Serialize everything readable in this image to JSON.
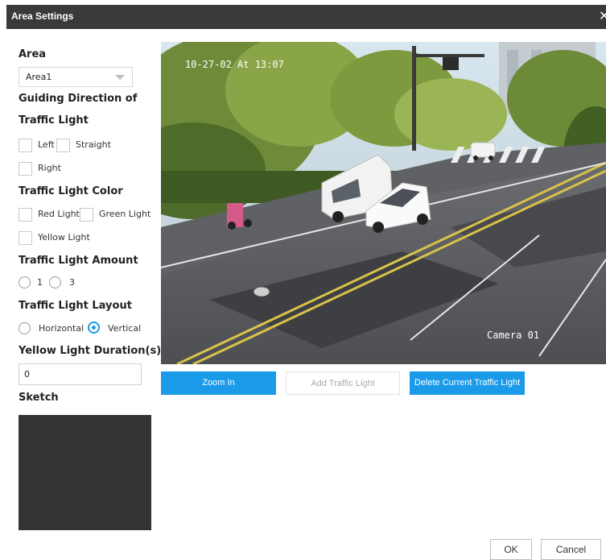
{
  "dialog": {
    "title": "Area Settings",
    "close_glyph": "✕"
  },
  "area": {
    "heading": "Area",
    "selected": "Area1"
  },
  "direction": {
    "heading_line1": "Guiding Direction of",
    "heading_line2": "Traffic Light",
    "left": "Left",
    "straight": "Straight",
    "right": "Right"
  },
  "color": {
    "heading": "Traffic Light Color",
    "red": "Red Light",
    "green": "Green Light",
    "yellow": "Yellow Light"
  },
  "amount": {
    "heading": "Traffic Light Amount",
    "opt1": "1",
    "opt3": "3"
  },
  "layout": {
    "heading": "Traffic Light Layout",
    "horizontal": "Horizontal",
    "vertical": "Vertical",
    "selected": "Vertical"
  },
  "duration": {
    "heading": "Yellow Light Duration(s)",
    "value": "0"
  },
  "sketch": {
    "heading": "Sketch"
  },
  "video": {
    "timestamp": "10-27-02 At 13:07",
    "camera_label": "Camera 01"
  },
  "buttons": {
    "zoom_in": "Zoom In",
    "add_traffic_light": "Add Traffic Light",
    "delete_current": "Delete Current Traffic Light",
    "ok": "OK",
    "cancel": "Cancel"
  },
  "colors": {
    "accent": "#1a9ae8",
    "titlebar": "#3a3a3a",
    "sketch_bg": "#333333"
  }
}
